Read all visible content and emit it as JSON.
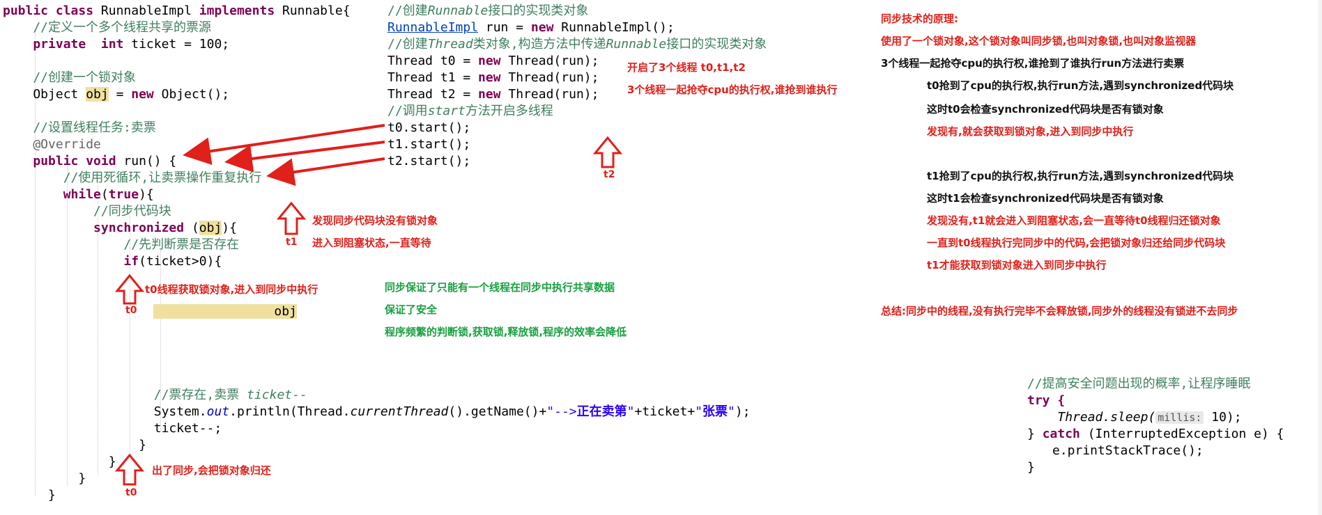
{
  "left_code": [
    "public class RunnableImpl implements Runnable{",
    "    //定义一个多个线程共享的票源",
    "    private  int ticket = 100;",
    "    //创建一个锁对象",
    "    Object obj = new Object();",
    "    //设置线程任务:卖票",
    "    @Override",
    "    public void run() {",
    "        //使用死循环,让卖票操作重复执行",
    "        while(true){",
    "            //同步代码块",
    "            synchronized (obj){",
    "                //先判断票是否存在",
    "                if(ticket>0){",
    "                obj",
    "                    //票存在,卖票 ticket--",
    "                    System.out.println(Thread.currentThread().getName()+\"-->正在卖第\"+ticket+\"张票\");",
    "                    ticket--;",
    "                }",
    "            }",
    "        }",
    "    }",
    "}"
  ],
  "middle_code": [
    "//创建Runnable接口的实现类对象",
    "RunnableImpl run = new RunnableImpl();",
    "//创建Thread类对象,构造方法中传递Runnable接口的实现类对象",
    "Thread t0 = new Thread(run);",
    "Thread t1 = new Thread(run);",
    "Thread t2 = new Thread(run);",
    "//调用start方法开启多线程",
    "t0.start();",
    "t1.start();",
    "t2.start();"
  ],
  "right_code": {
    "comment": "//提高安全问题出现的概率,让程序睡眠",
    "line_try": "try {",
    "sleep_prefix": "Thread.sleep(",
    "param_hint": "millis:",
    "sleep_suffix": " 10);",
    "line_catch": "} catch (InterruptedException e) {",
    "line_trace": "e.printStackTrace();",
    "line_close": "}"
  },
  "notes": {
    "threads_started": "开启了3个线程 t0,t1,t2",
    "compete": "3个线程一起抢夺cpu的执行权,谁抢到谁执行",
    "t1_no_lock": "发现同步代码块没有锁对象",
    "t1_blocked": "进入到阻塞状态,一直等待",
    "t0_acquire": "t0线程获取锁对象,进入到同步中执行",
    "t0_release": "出了同步,会把锁对象归还",
    "sync_only_one": "同步保证了只能有一个线程在同步中执行共享数据",
    "sync_safe": "保证了安全",
    "sync_slow": "程序频繁的判断锁,获取锁,释放锁,程序的效率会降低",
    "principle_title": "同步技术的原理:",
    "principle_1": "使用了一个锁对象,这个锁对象叫同步锁,也叫对象锁,也叫对象监视器",
    "principle_2": "3个线程一起抢夺cpu的执行权,谁抢到了谁执行run方法进行卖票",
    "t0_p1": "t0抢到了cpu的执行权,执行run方法,遇到synchronized代码块",
    "t0_p2": "这时t0会检查synchronized代码块是否有锁对象",
    "t0_p3": "发现有,就会获取到锁对象,进入到同步中执行",
    "t1_p1": "t1抢到了cpu的执行权,执行run方法,遇到synchronized代码块",
    "t1_p2": "这时t1会检查synchronized代码块是否有锁对象",
    "t1_p3": "发现没有,t1就会进入到阻塞状态,会一直等待t0线程归还锁对象",
    "t1_p4": "一直到t0线程执行完同步中的代码,会把锁对象归还给同步代码块",
    "t1_p5": "t1才能获取到锁对象进入到同步中执行",
    "summary": "总结:同步中的线程,没有执行完毕不会释放锁,同步外的线程没有锁进不去同步"
  },
  "labels": {
    "t0_a": "t0",
    "t0_b": "t0",
    "t1": "t1",
    "t2": "t2"
  },
  "colors": {
    "keyword": "#7f0055",
    "comment": "#3f7f5f",
    "string": "#2a00ff",
    "annotation_red": "#e0201a",
    "annotation_green": "#18a040"
  }
}
